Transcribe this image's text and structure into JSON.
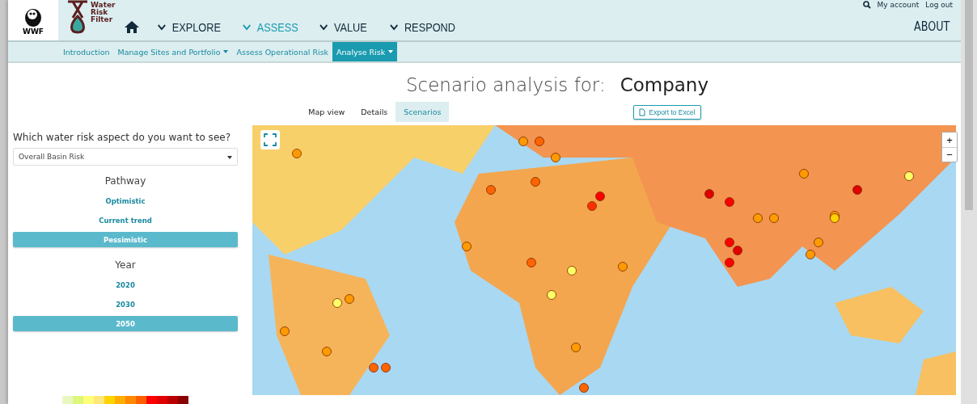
{
  "header": {
    "logo_text": "WWF",
    "brand": [
      "Water",
      "Risk",
      "Filter"
    ],
    "nav": [
      {
        "label": "EXPLORE",
        "selected": false
      },
      {
        "label": "ASSESS",
        "selected": true
      },
      {
        "label": "VALUE",
        "selected": false
      },
      {
        "label": "RESPOND",
        "selected": false
      }
    ],
    "account_links": [
      "My account",
      "Log out"
    ],
    "about": "ABOUT"
  },
  "subnav": [
    {
      "label": "Introduction",
      "selected": false,
      "dropdown": false
    },
    {
      "label": "Manage Sites and Portfolio",
      "selected": false,
      "dropdown": true
    },
    {
      "label": "Assess Operational Risk",
      "selected": false,
      "dropdown": false
    },
    {
      "label": "Analyse Risk",
      "selected": true,
      "dropdown": true
    }
  ],
  "title": {
    "prefix": "Scenario analysis for:",
    "subject": "Company"
  },
  "view_tabs": [
    {
      "label": "Map view",
      "selected": false
    },
    {
      "label": "Details",
      "selected": false
    },
    {
      "label": "Scenarios",
      "selected": true
    }
  ],
  "export_button": "Export to Excel",
  "sidebar": {
    "question": "Which water risk aspect do you want to see?",
    "aspect": "Overall Basin Risk",
    "pathway": {
      "heading": "Pathway",
      "options": [
        {
          "label": "Optimistic",
          "selected": false
        },
        {
          "label": "Current trend",
          "selected": false
        },
        {
          "label": "Pessimistic",
          "selected": true
        }
      ]
    },
    "year": {
      "heading": "Year",
      "options": [
        {
          "label": "2020",
          "selected": false
        },
        {
          "label": "2030",
          "selected": false
        },
        {
          "label": "2050",
          "selected": true
        }
      ]
    },
    "legend": [
      {
        "color": "#e8f7c0"
      },
      {
        "color": "#dcf77a"
      },
      {
        "color": "#ffff77"
      },
      {
        "color": "#ffe87a"
      },
      {
        "color": "#ffd200"
      },
      {
        "color": "#ffad00"
      },
      {
        "color": "#ff8a00"
      },
      {
        "color": "#ff5f00"
      },
      {
        "color": "#ff0000"
      },
      {
        "color": "#e00000"
      },
      {
        "color": "#b80000"
      },
      {
        "color": "#8b0000"
      }
    ]
  },
  "map": {
    "zoom_in": "+",
    "zoom_out": "−"
  }
}
